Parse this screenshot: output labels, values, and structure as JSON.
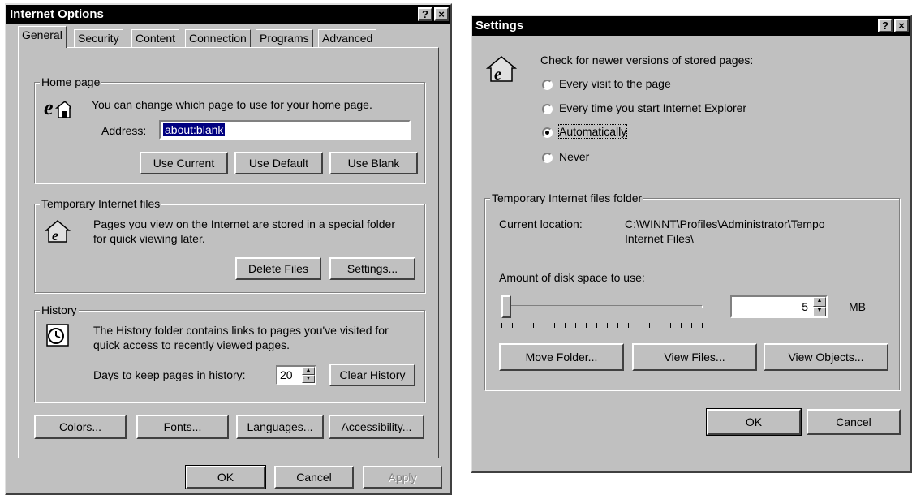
{
  "left": {
    "title": "Internet Options",
    "help_btn": "?",
    "close_btn": "×",
    "tabs": [
      "General",
      "Security",
      "Content",
      "Connection",
      "Programs",
      "Advanced"
    ],
    "home": {
      "legend": "Home page",
      "desc": "You can change which page to use for your home page.",
      "address_label": "Address:",
      "address_value": "about:blank",
      "btn_current": "Use Current",
      "btn_default": "Use Default",
      "btn_blank": "Use Blank"
    },
    "temp": {
      "legend": "Temporary Internet files",
      "desc1": "Pages you view on the Internet are stored in a special folder",
      "desc2": "for quick viewing later.",
      "btn_delete": "Delete Files",
      "btn_settings": "Settings..."
    },
    "history": {
      "legend": "History",
      "desc1": "The History folder contains links to pages you've visited for",
      "desc2": "quick access to recently viewed pages.",
      "days_label": "Days to keep pages in history:",
      "days_value": "20",
      "btn_clear": "Clear History"
    },
    "bottom": {
      "colors": "Colors...",
      "fonts": "Fonts...",
      "languages": "Languages...",
      "accessibility": "Accessibility..."
    },
    "ok": "OK",
    "cancel": "Cancel",
    "apply": "Apply"
  },
  "right": {
    "title": "Settings",
    "help_btn": "?",
    "close_btn": "×",
    "check_label": "Check for newer versions of stored pages:",
    "options": [
      "Every visit to the page",
      "Every time you start Internet Explorer",
      "Automatically",
      "Never"
    ],
    "selected_option": "Automatically",
    "folder": {
      "legend": "Temporary Internet files folder",
      "location_label": "Current location:",
      "location_line1": "C:\\WINNT\\Profiles\\Administrator\\Tempo",
      "location_line2": "Internet Files\\",
      "disk_label": "Amount of disk space to use:",
      "disk_value": "5",
      "disk_unit": "MB",
      "slider_level": 0,
      "btn_move": "Move Folder...",
      "btn_view_files": "View Files...",
      "btn_view_objects": "View Objects..."
    },
    "ok": "OK",
    "cancel": "Cancel"
  }
}
